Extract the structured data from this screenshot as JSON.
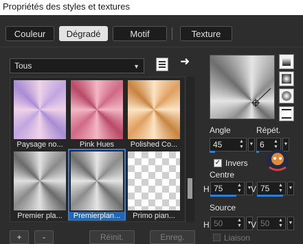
{
  "window": {
    "title": "Propriétés des styles et textures"
  },
  "tabs": [
    {
      "label": "Couleur",
      "active": false
    },
    {
      "label": "Dégradé",
      "active": true
    },
    {
      "label": "Motif",
      "active": false
    },
    {
      "label": "Texture",
      "active": false
    }
  ],
  "gradient_category": {
    "selected": "Tous"
  },
  "thumbnails": [
    {
      "label": "Paysage no...",
      "colors": [
        "#c0a6e0",
        "#f0d2e8",
        "#a88cd4"
      ]
    },
    {
      "label": "Pink Hues",
      "colors": [
        "#d06a86",
        "#f2b6c4",
        "#b84a66"
      ]
    },
    {
      "label": "Polished Co...",
      "colors": [
        "#e0a060",
        "#fbe4c4",
        "#c88440"
      ]
    },
    {
      "label": "Premier pla...",
      "colors": [
        "#8a8a8a",
        "#e0e0e0",
        "#6a6a6a"
      ]
    },
    {
      "label": "Premierplan...",
      "colors": [
        "#8c8c8c",
        "#e4e4e4",
        "#6e6e6e"
      ],
      "selected": true
    },
    {
      "label": "Primo pian...",
      "colors": [
        "#ffffff",
        "#cfcfcf",
        "#e8e8e8"
      ]
    }
  ],
  "footer": {
    "add_label": "+",
    "remove_label": "-",
    "reset_label": "Réinit.",
    "save_label": "Enreg."
  },
  "settings": {
    "angle_label": "Angle",
    "angle_value": "45",
    "repeat_label": "Répét.",
    "repeat_value": "6",
    "invert_label": "Invers",
    "invert_checked": true,
    "center_label": "Centre",
    "center_h_label": "H",
    "center_h_value": "75",
    "center_v_label": "V",
    "center_v_value": "75",
    "source_label": "Source",
    "source_h_label": "H",
    "source_h_value": "50",
    "source_v_label": "V",
    "source_v_value": "50",
    "link_label": "Liaison"
  },
  "colors": {
    "accent": "#2f7fd6",
    "background": "#2d2d2d"
  }
}
